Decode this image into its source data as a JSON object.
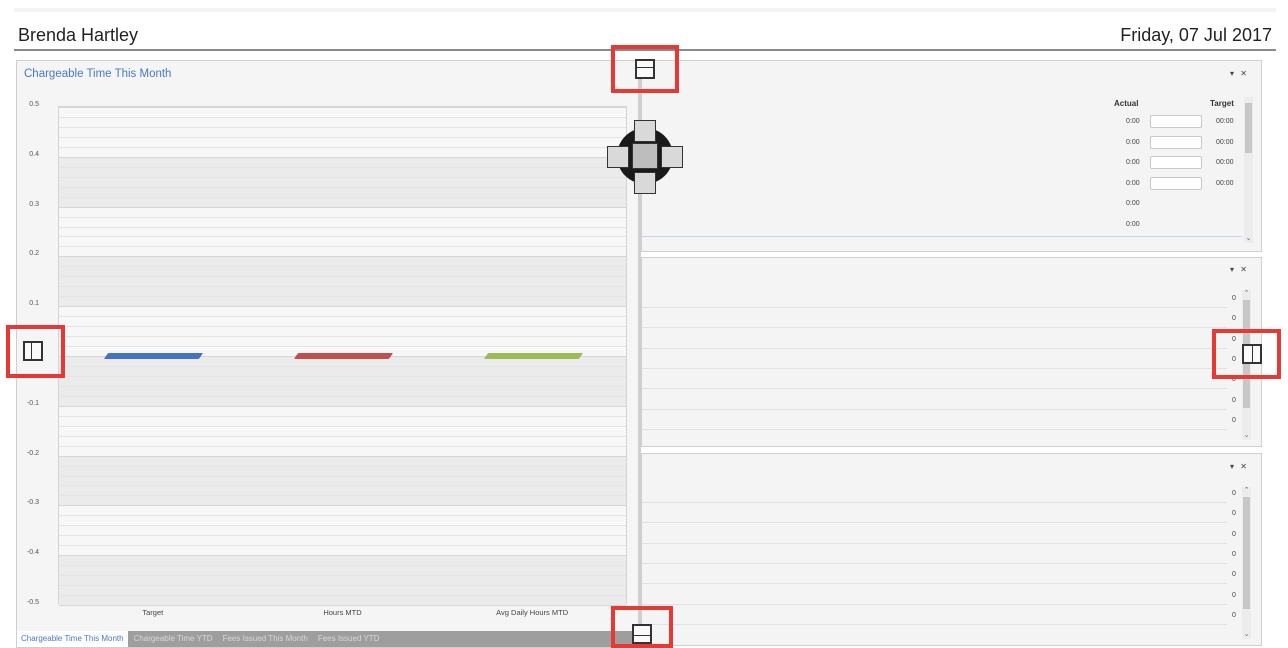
{
  "header": {
    "user_name": "Brenda Hartley",
    "date": "Friday, 07 Jul 2017"
  },
  "left_panel": {
    "title": "Chargeable Time This Month",
    "tabs": [
      {
        "label": "Chargeable Time This Month",
        "active": true
      },
      {
        "label": "Chargeable Time YTD",
        "active": false
      },
      {
        "label": "Fees Issued This Month",
        "active": false
      },
      {
        "label": "Fees Issued YTD",
        "active": false
      }
    ]
  },
  "chart_data": {
    "type": "bar",
    "categories": [
      "Target",
      "Hours MTD",
      "Avg Daily Hours MTD"
    ],
    "values": [
      0,
      0,
      0
    ],
    "colors": [
      "#4472c4",
      "#c0504d",
      "#9bbb59"
    ],
    "ylim": [
      -0.5,
      0.5
    ],
    "yticks": [
      "0.5",
      "0.4",
      "0.3",
      "0.2",
      "0.1",
      "0",
      "-0.1",
      "-0.2",
      "-0.3",
      "-0.4",
      "-0.5"
    ],
    "grid": true
  },
  "right_panel_1": {
    "controls": "▾ ✕",
    "actual_header": "Actual",
    "target_header": "Target",
    "rows": [
      {
        "actual": "0:00",
        "target": "00:00",
        "has_input": true
      },
      {
        "actual": "0:00",
        "target": "00:00",
        "has_input": true
      },
      {
        "actual": "0:00",
        "target": "00:00",
        "has_input": true
      },
      {
        "actual": "0:00",
        "target": "00:00",
        "has_input": true
      },
      {
        "actual": "0:00",
        "target": "",
        "has_input": false
      },
      {
        "actual": "0:00",
        "target": "",
        "has_input": false
      }
    ]
  },
  "right_panel_2": {
    "controls": "▾ ✕",
    "values": [
      "0",
      "0",
      "0",
      "0",
      "0",
      "0",
      "0"
    ]
  },
  "right_panel_3": {
    "controls": "▾ ✕",
    "values": [
      "0",
      "0",
      "0",
      "0",
      "0",
      "0",
      "0"
    ]
  },
  "icons": {
    "scroll_up": "⌃",
    "scroll_down": "⌄"
  }
}
